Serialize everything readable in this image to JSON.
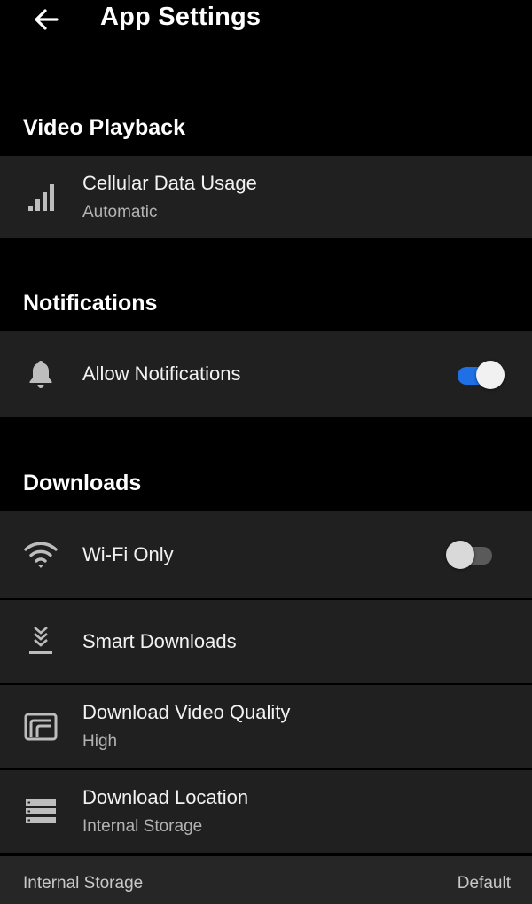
{
  "header": {
    "title": "App Settings"
  },
  "sections": {
    "video_playback": {
      "title": "Video Playback",
      "cellular": {
        "title": "Cellular Data Usage",
        "subtitle": "Automatic"
      }
    },
    "notifications": {
      "title": "Notifications",
      "allow": {
        "title": "Allow Notifications",
        "enabled": true
      }
    },
    "downloads": {
      "title": "Downloads",
      "wifi_only": {
        "title": "Wi-Fi Only",
        "enabled": false
      },
      "smart_downloads": {
        "title": "Smart Downloads"
      },
      "video_quality": {
        "title": "Download Video Quality",
        "subtitle": "High"
      },
      "location": {
        "title": "Download Location",
        "subtitle": "Internal Storage"
      }
    }
  },
  "footer": {
    "left": "Internal Storage",
    "right": "Default"
  },
  "colors": {
    "accent": "#1f6fe5",
    "row_bg": "#202020",
    "background": "#000000"
  }
}
